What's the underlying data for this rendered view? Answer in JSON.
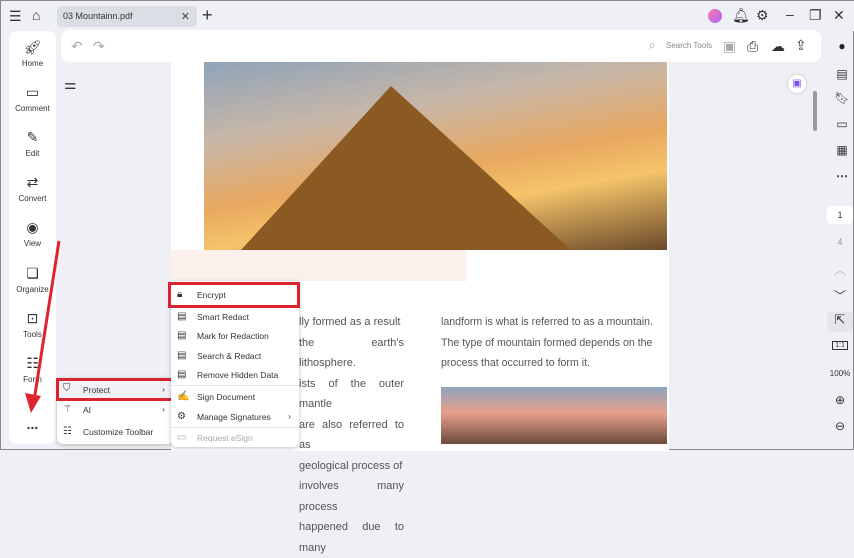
{
  "titlebar": {
    "tab_title": "03 Mountainn.pdf",
    "colors": {
      "accent_red": "#d9232e"
    }
  },
  "toolbar": {
    "search_placeholder": "Search Tools"
  },
  "sidebar": {
    "items": [
      {
        "label": "Home",
        "icon": "rocket-icon"
      },
      {
        "label": "Comment",
        "icon": "comment-icon"
      },
      {
        "label": "Edit",
        "icon": "edit-icon"
      },
      {
        "label": "Convert",
        "icon": "convert-icon"
      },
      {
        "label": "View",
        "icon": "eye-icon"
      },
      {
        "label": "Organize",
        "icon": "organize-icon"
      },
      {
        "label": "Tools",
        "icon": "toolbox-icon"
      },
      {
        "label": "Form",
        "icon": "form-icon"
      }
    ],
    "more": "..."
  },
  "menu": {
    "items": [
      {
        "label": "Protect"
      },
      {
        "label": "AI"
      },
      {
        "label": "Customize Toolbar"
      }
    ]
  },
  "submenu": {
    "items": [
      {
        "label": "Encrypt"
      },
      {
        "label": "Smart Redact"
      },
      {
        "label": "Mark for Redaction"
      },
      {
        "label": "Search & Redact"
      },
      {
        "label": "Remove Hidden Data"
      },
      {
        "label": "Sign Document"
      },
      {
        "label": "Manage Signatures"
      },
      {
        "label": "Request eSign"
      }
    ]
  },
  "document": {
    "left_col": [
      "lly formed as a result",
      "the earth's lithosphere.",
      "ists of the outer mantle",
      "are also referred to as",
      "geological process of",
      "involves many process",
      "happened due to many"
    ],
    "right_col": [
      "landform is what is referred to as a mountain.",
      "The type of mountain formed depends on the",
      "process that occurred to form it."
    ]
  },
  "pagenav": {
    "current": "1",
    "total": "4",
    "zoom": "100%",
    "fit": "1:1"
  }
}
